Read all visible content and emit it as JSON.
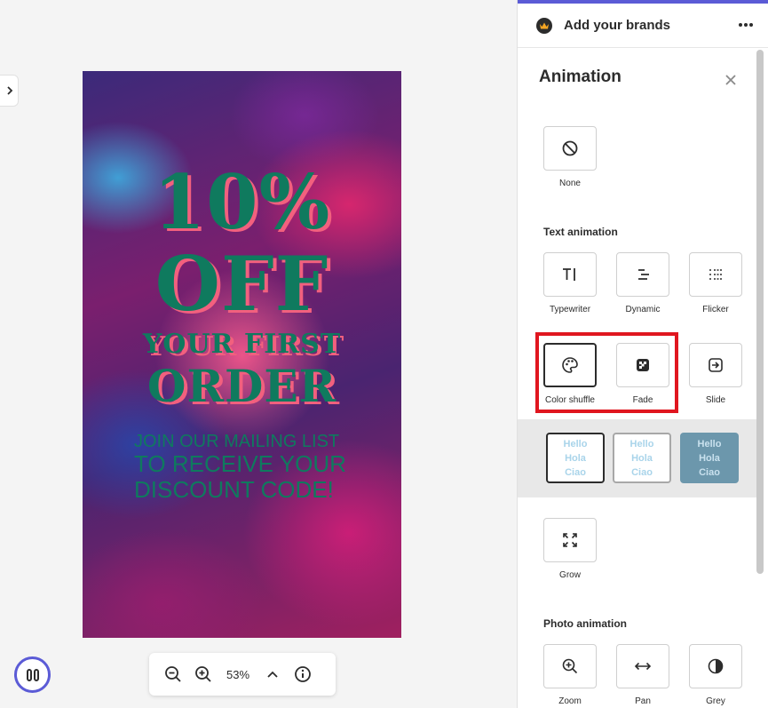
{
  "poster": {
    "line1": "10%",
    "line2": "OFF",
    "line3": "YOUR FIRST",
    "line4": "ORDER",
    "sub1": "JOIN OUR MAILING LIST",
    "sub2": "TO RECEIVE YOUR",
    "sub3": "DISCOUNT CODE!"
  },
  "zoom": {
    "percent": "53%"
  },
  "panel": {
    "brand_title": "Add your brands",
    "animation_title": "Animation",
    "none_label": "None",
    "text_animation_heading": "Text animation",
    "text_items": [
      {
        "label": "Typewriter",
        "icon": "typewriter-icon"
      },
      {
        "label": "Dynamic",
        "icon": "dynamic-icon"
      },
      {
        "label": "Flicker",
        "icon": "flicker-icon"
      },
      {
        "label": "Color shuffle",
        "icon": "palette-icon"
      },
      {
        "label": "Fade",
        "icon": "fade-icon"
      },
      {
        "label": "Slide",
        "icon": "slide-icon"
      },
      {
        "label": "Grow",
        "icon": "grow-icon"
      }
    ],
    "variants": [
      {
        "l1": "Hello",
        "l2": "Hola",
        "l3": "Ciao"
      },
      {
        "l1": "Hello",
        "l2": "Hola",
        "l3": "Ciao"
      },
      {
        "l1": "Hello",
        "l2": "Hola",
        "l3": "Ciao"
      }
    ],
    "photo_animation_heading": "Photo animation",
    "photo_items": [
      {
        "label": "Zoom",
        "icon": "zoom-in-icon"
      },
      {
        "label": "Pan",
        "icon": "pan-icon"
      },
      {
        "label": "Grey",
        "icon": "grey-icon"
      }
    ],
    "selected_variant": 0,
    "highlight_color": "#e0161f",
    "accent_color": "#5b5bd6"
  }
}
